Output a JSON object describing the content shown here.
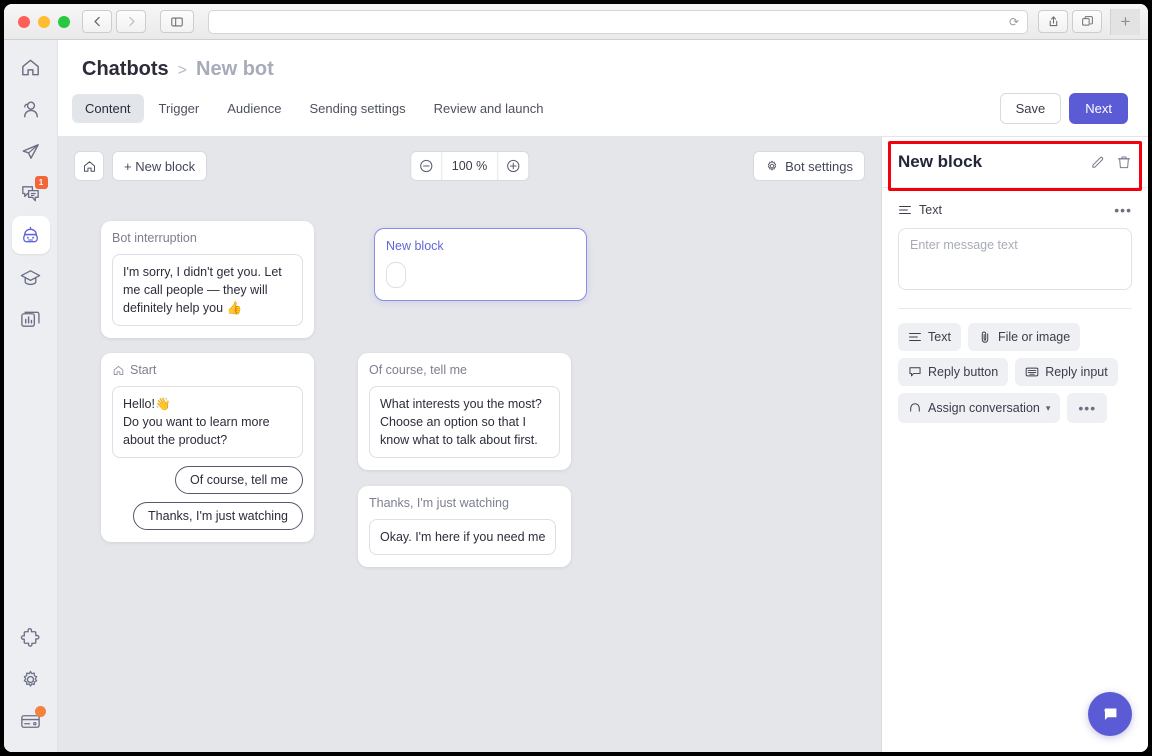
{
  "browser": {
    "back_icon": "chevron-left-icon",
    "forward_icon": "chevron-right-icon",
    "sidebar_icon": "sidebar-toggle-icon",
    "url_value": "",
    "reload_icon": "reload-icon",
    "share_icon": "share-icon",
    "tabs_icon": "tab-overview-icon",
    "newtab_label": "+"
  },
  "rail": {
    "items": [
      {
        "name": "home",
        "icon": "home-icon",
        "badge": ""
      },
      {
        "name": "contacts",
        "icon": "contacts-icon",
        "badge": ""
      },
      {
        "name": "campaigns",
        "icon": "paper-plane-icon",
        "badge": ""
      },
      {
        "name": "chats",
        "icon": "chats-icon",
        "badge": "1"
      },
      {
        "name": "chatbots",
        "icon": "bot-icon",
        "badge": ""
      },
      {
        "name": "academy",
        "icon": "graduation-cap-icon",
        "badge": ""
      },
      {
        "name": "reports",
        "icon": "reports-icon",
        "badge": ""
      }
    ],
    "bottom_items": [
      {
        "name": "integrations",
        "icon": "puzzle-icon",
        "dot": false
      },
      {
        "name": "settings",
        "icon": "gear-icon",
        "dot": false
      },
      {
        "name": "billing",
        "icon": "credit-card-icon",
        "dot": true
      }
    ]
  },
  "breadcrumb": {
    "root": "Chatbots",
    "separator": ">",
    "current": "New bot"
  },
  "tabs": [
    {
      "label": "Content",
      "selected": true
    },
    {
      "label": "Trigger",
      "selected": false
    },
    {
      "label": "Audience",
      "selected": false
    },
    {
      "label": "Sending settings",
      "selected": false
    },
    {
      "label": "Review and launch",
      "selected": false
    }
  ],
  "top_actions": {
    "save": "Save",
    "next": "Next"
  },
  "canvas_toolbar": {
    "home_icon": "home-icon",
    "new_block": "+ New block",
    "zoom_out_icon": "zoom-out-icon",
    "zoom_value": "100 %",
    "zoom_in_icon": "zoom-in-icon",
    "bot_settings": "Bot settings",
    "bot_settings_icon": "gear-icon"
  },
  "flow": {
    "bot_interruption": {
      "title": "Bot interruption",
      "message": "I'm sorry, I didn't get you. Let me call people — they will definitely help you 👍"
    },
    "new_block": {
      "title": "New block"
    },
    "start": {
      "title": "Start",
      "icon": "home-icon",
      "message": "Hello!👋\nDo you want to learn more about the product?",
      "replies": [
        "Of course, tell me",
        "Thanks, I'm just watching"
      ]
    },
    "of_course": {
      "title": "Of course, tell me",
      "message": "What interests you the most? Choose an option so that I know what to talk about first."
    },
    "just_watching": {
      "title": "Thanks, I'm just watching",
      "message": "Okay. I'm here if you need me"
    }
  },
  "panel": {
    "title": "New block",
    "edit_icon": "pencil-icon",
    "delete_icon": "trash-icon",
    "section_label": "Text",
    "section_icon": "text-lines-icon",
    "section_menu": "•••",
    "message_placeholder": "Enter message text",
    "chips": [
      {
        "label": "Text",
        "icon": "text-lines-icon"
      },
      {
        "label": "File or image",
        "icon": "paperclip-icon"
      },
      {
        "label": "Reply button",
        "icon": "speech-bubble-icon"
      },
      {
        "label": "Reply input",
        "icon": "keyboard-icon"
      },
      {
        "label": "Assign conversation",
        "icon": "headset-icon",
        "caret": "▾"
      },
      {
        "label": "•••",
        "icon": ""
      }
    ]
  },
  "fab": {
    "icon": "chat-widget-icon"
  },
  "colors": {
    "accent": "#5b5bd6",
    "canvas_bg": "#e4e6ea",
    "rail_bg": "#eceef1",
    "highlight": "#f3000d",
    "badge": "#f4663a"
  }
}
